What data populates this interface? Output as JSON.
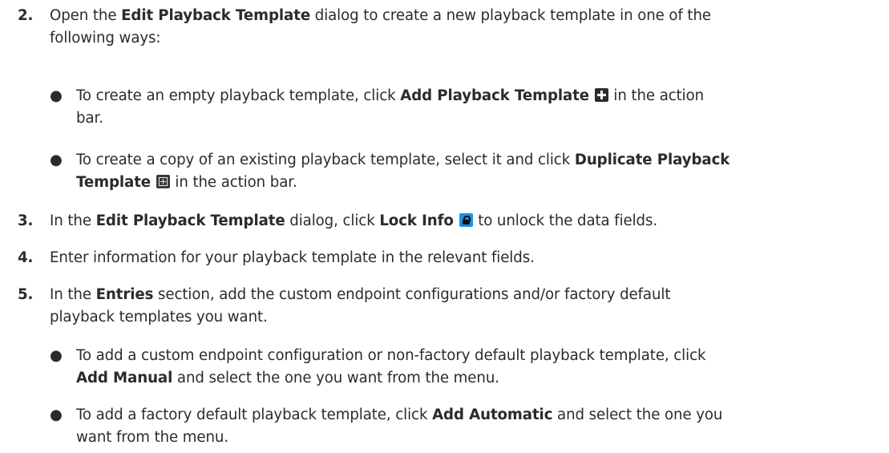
{
  "steps": [
    {
      "num": "2.",
      "text_before": "Open the ",
      "bold1": "Edit Playback Template",
      "text_after": " dialog to create a new playback template in one of the",
      "line2": "following ways:"
    },
    {
      "num": "3.",
      "t1": "In the ",
      "bold1": "Edit Playback Template",
      "t2": " dialog, click ",
      "bold2": "Lock Info",
      "t3": " to unlock the data fields."
    },
    {
      "num": "4.",
      "text": "Enter information for your playback template in the relevant fields."
    },
    {
      "num": "5.",
      "t1": "In the ",
      "bold1": "Entries",
      "t2": " section, add the custom endpoint configurations and/or factory default",
      "line2": "playback templates you want."
    }
  ],
  "bullets": [
    {
      "dot": "●",
      "t1": "To create an empty playback template, click ",
      "bold1": "Add Playback Template",
      "t2": " in the action",
      "line2": "bar."
    },
    {
      "dot": "●",
      "t1": "To create a copy of an existing playback template, select it and click ",
      "bold1": "Duplicate Playback",
      "bold2": "Template",
      "t2": " in the action bar."
    },
    {
      "dot": "●",
      "t1": "To add a custom endpoint configuration or non-factory default playback template, click",
      "bold1": "Add Manual",
      "t2": " and select the one you want from the menu."
    },
    {
      "dot": "●",
      "t1": "To add a factory default playback template, click ",
      "bold1": "Add Automatic",
      "t2": " and select the one you",
      "line2": "want from the menu."
    }
  ],
  "icons": {
    "add": "plus-square-icon",
    "duplicate": "duplicate-icon",
    "lock": "lock-icon",
    "lock_color": "#1f8fe6"
  }
}
